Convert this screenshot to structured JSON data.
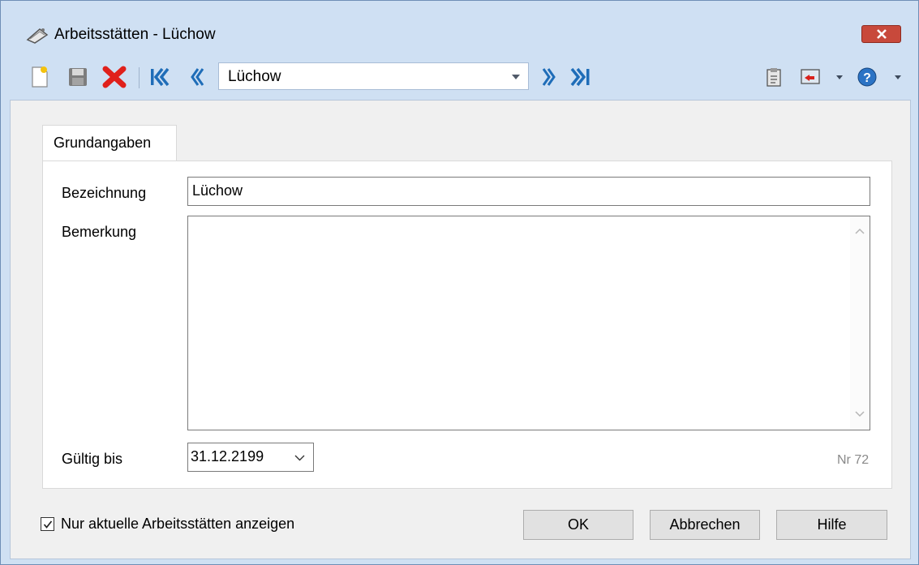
{
  "window": {
    "title": "Arbeitsstätten - Lüchow",
    "close_icon": "close-icon"
  },
  "toolbar": {
    "record_value": "Lüchow",
    "icons": [
      "new-icon",
      "save-icon",
      "delete-icon",
      "first-record-icon",
      "previous-record-icon",
      "next-record-icon",
      "last-record-icon",
      "clipboard-icon",
      "export-icon",
      "help-icon"
    ]
  },
  "tabs": [
    {
      "label": "Grundangaben",
      "active": true
    }
  ],
  "form": {
    "bezeichnung_label": "Bezeichnung",
    "bezeichnung_value": "Lüchow",
    "bemerkung_label": "Bemerkung",
    "bemerkung_value": "",
    "gueltig_label": "Gültig bis",
    "gueltig_value": "31.12.2199",
    "nr_text": "Nr 72"
  },
  "footer": {
    "checkbox_label": "Nur aktuelle Arbeitsstätten anzeigen",
    "checkbox_checked": true,
    "ok_label": "OK",
    "cancel_label": "Abbrechen",
    "help_label": "Hilfe"
  },
  "colors": {
    "frame": "#cfe0f3",
    "close_red": "#c8493b",
    "nav_blue": "#1f6db8",
    "delete_red": "#e0201b",
    "dialog_bg": "#f0f0f0"
  }
}
